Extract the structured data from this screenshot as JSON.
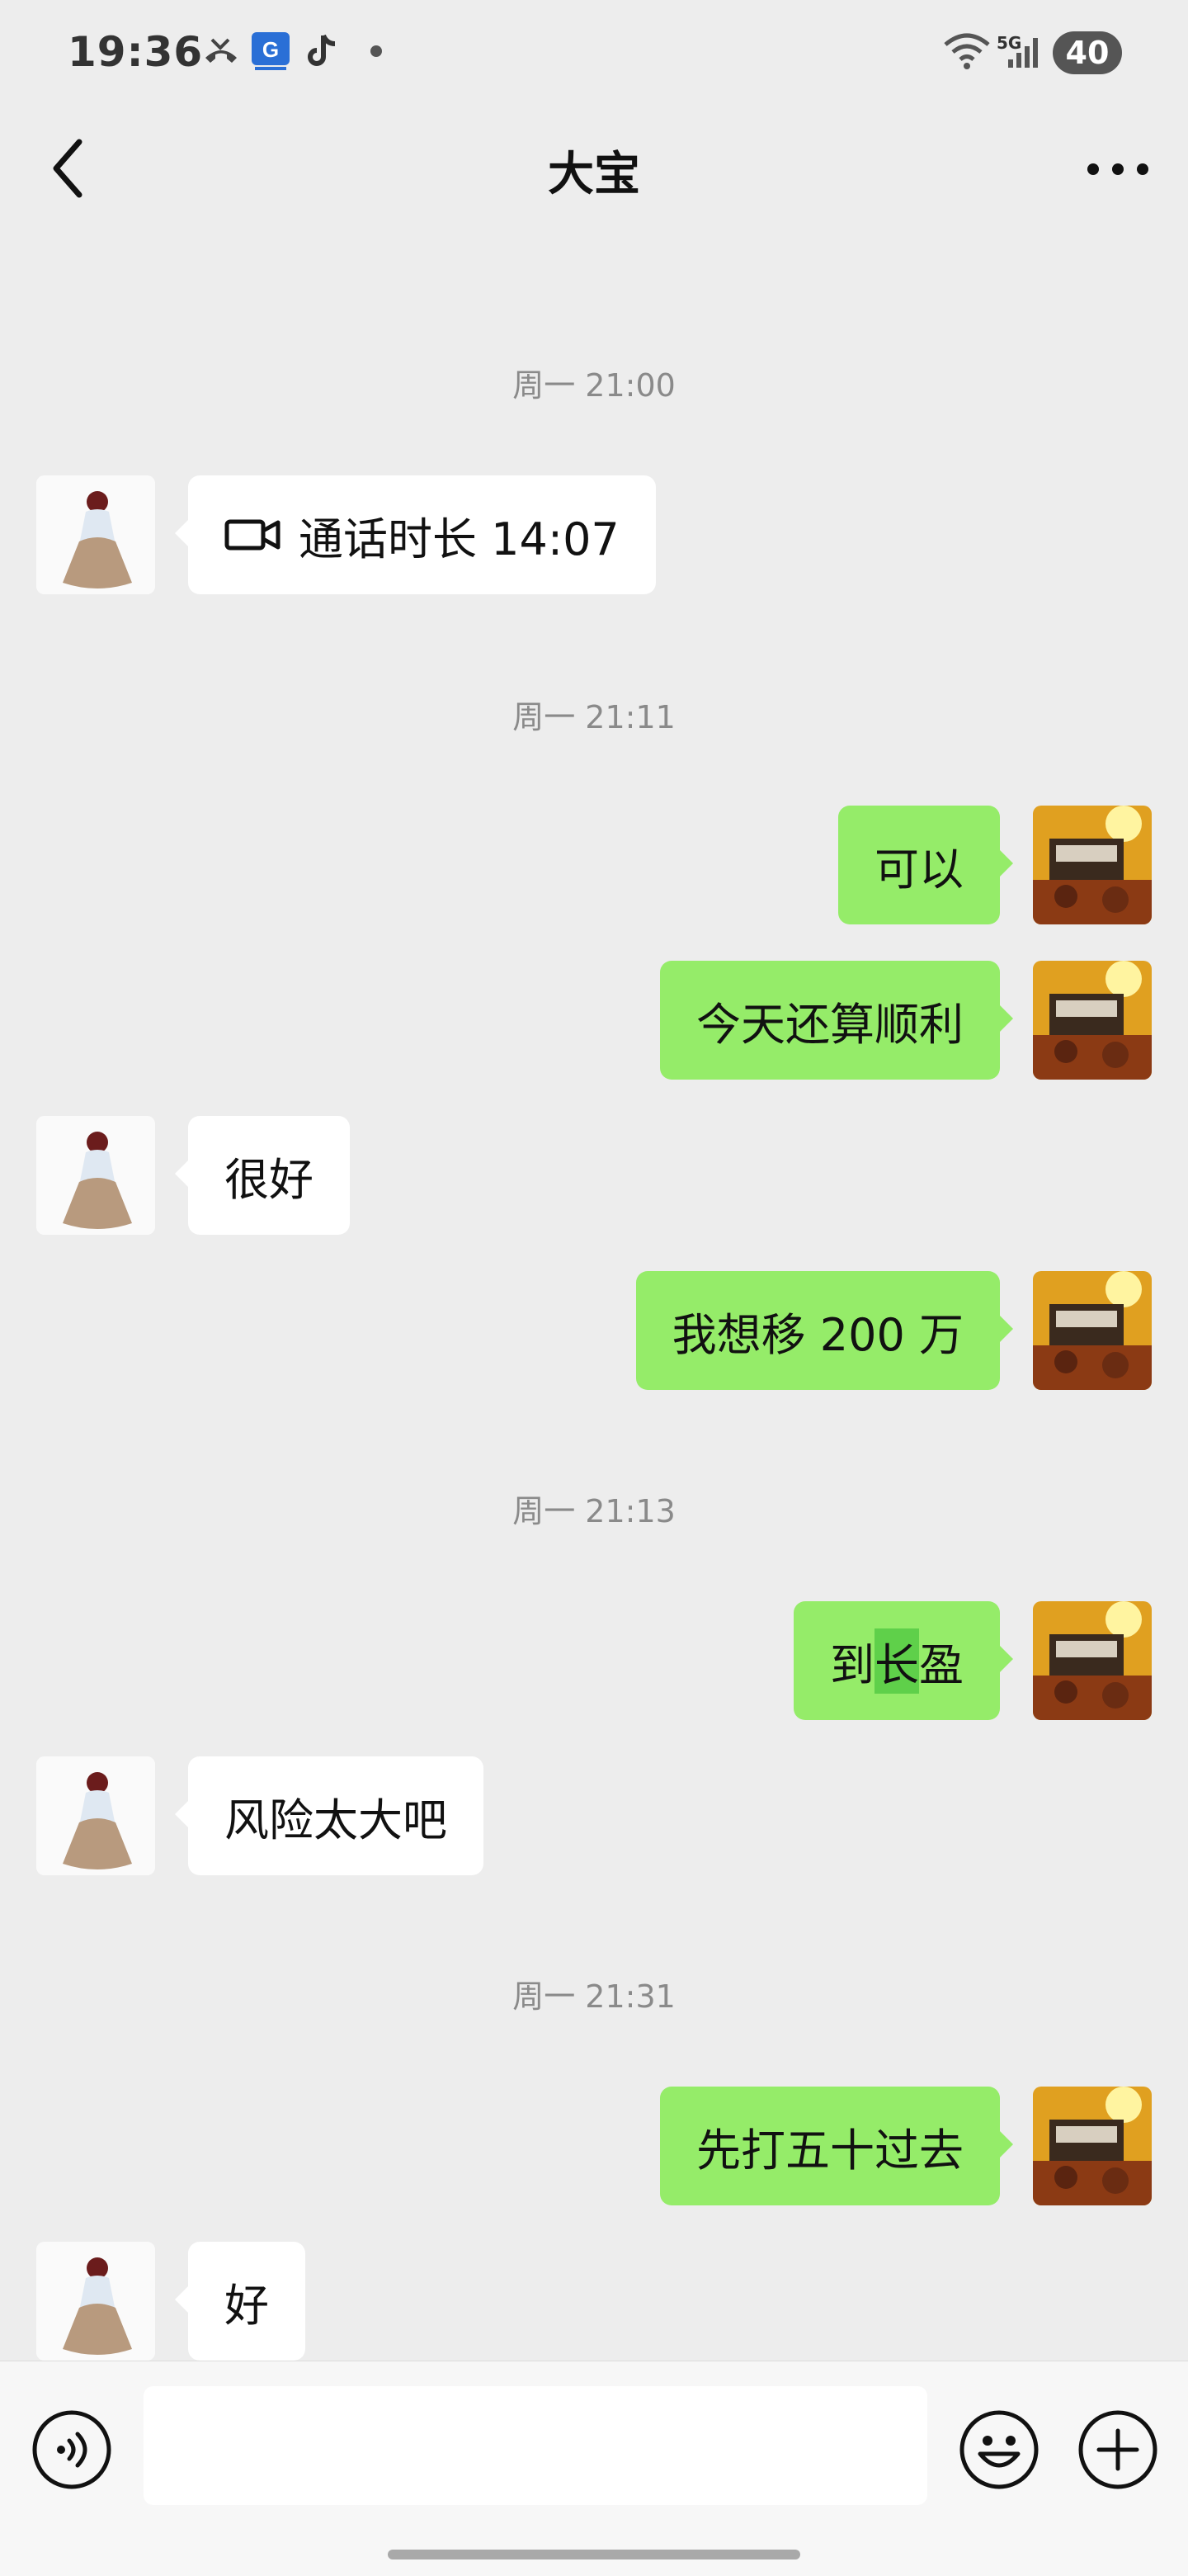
{
  "status_bar": {
    "time": "19:36",
    "network": "5G",
    "battery": "40",
    "icons": [
      "missed-call-icon",
      "app-notification-icon",
      "tiktok-icon",
      "dot-icon",
      "wifi-icon",
      "signal-icon"
    ]
  },
  "header": {
    "title": "大宝",
    "back_icon": "chevron-left-icon",
    "more_icon": "more-dots-icon"
  },
  "messages": [
    {
      "type": "timestamp",
      "text": "周一 21:00"
    },
    {
      "type": "call",
      "side": "left",
      "text": "通话时长 14:07",
      "icon": "video-call-icon"
    },
    {
      "type": "timestamp",
      "text": "周一 21:11"
    },
    {
      "type": "text",
      "side": "right",
      "text": "可以"
    },
    {
      "type": "text",
      "side": "right",
      "text": "今天还算顺利"
    },
    {
      "type": "text",
      "side": "left",
      "text": "很好"
    },
    {
      "type": "text",
      "side": "right",
      "text": "我想移 200 万"
    },
    {
      "type": "timestamp",
      "text": "周一 21:13"
    },
    {
      "type": "text",
      "side": "right",
      "text_parts": [
        "到",
        "长",
        "盈"
      ],
      "highlighted_part": "长"
    },
    {
      "type": "text",
      "side": "left",
      "text": "风险太大吧"
    },
    {
      "type": "timestamp",
      "text": "周一 21:31"
    },
    {
      "type": "text",
      "side": "right",
      "text": "先打五十过去"
    },
    {
      "type": "text",
      "side": "left",
      "text": "好"
    }
  ],
  "input_bar": {
    "value": "",
    "icons": [
      "voice-icon",
      "emoji-icon",
      "plus-icon"
    ]
  },
  "colors": {
    "background": "#ededed",
    "outgoing_bubble": "#95ec69",
    "incoming_bubble": "#ffffff",
    "highlight": "#5fd04a",
    "timestamp_text": "#8a8a8a"
  }
}
